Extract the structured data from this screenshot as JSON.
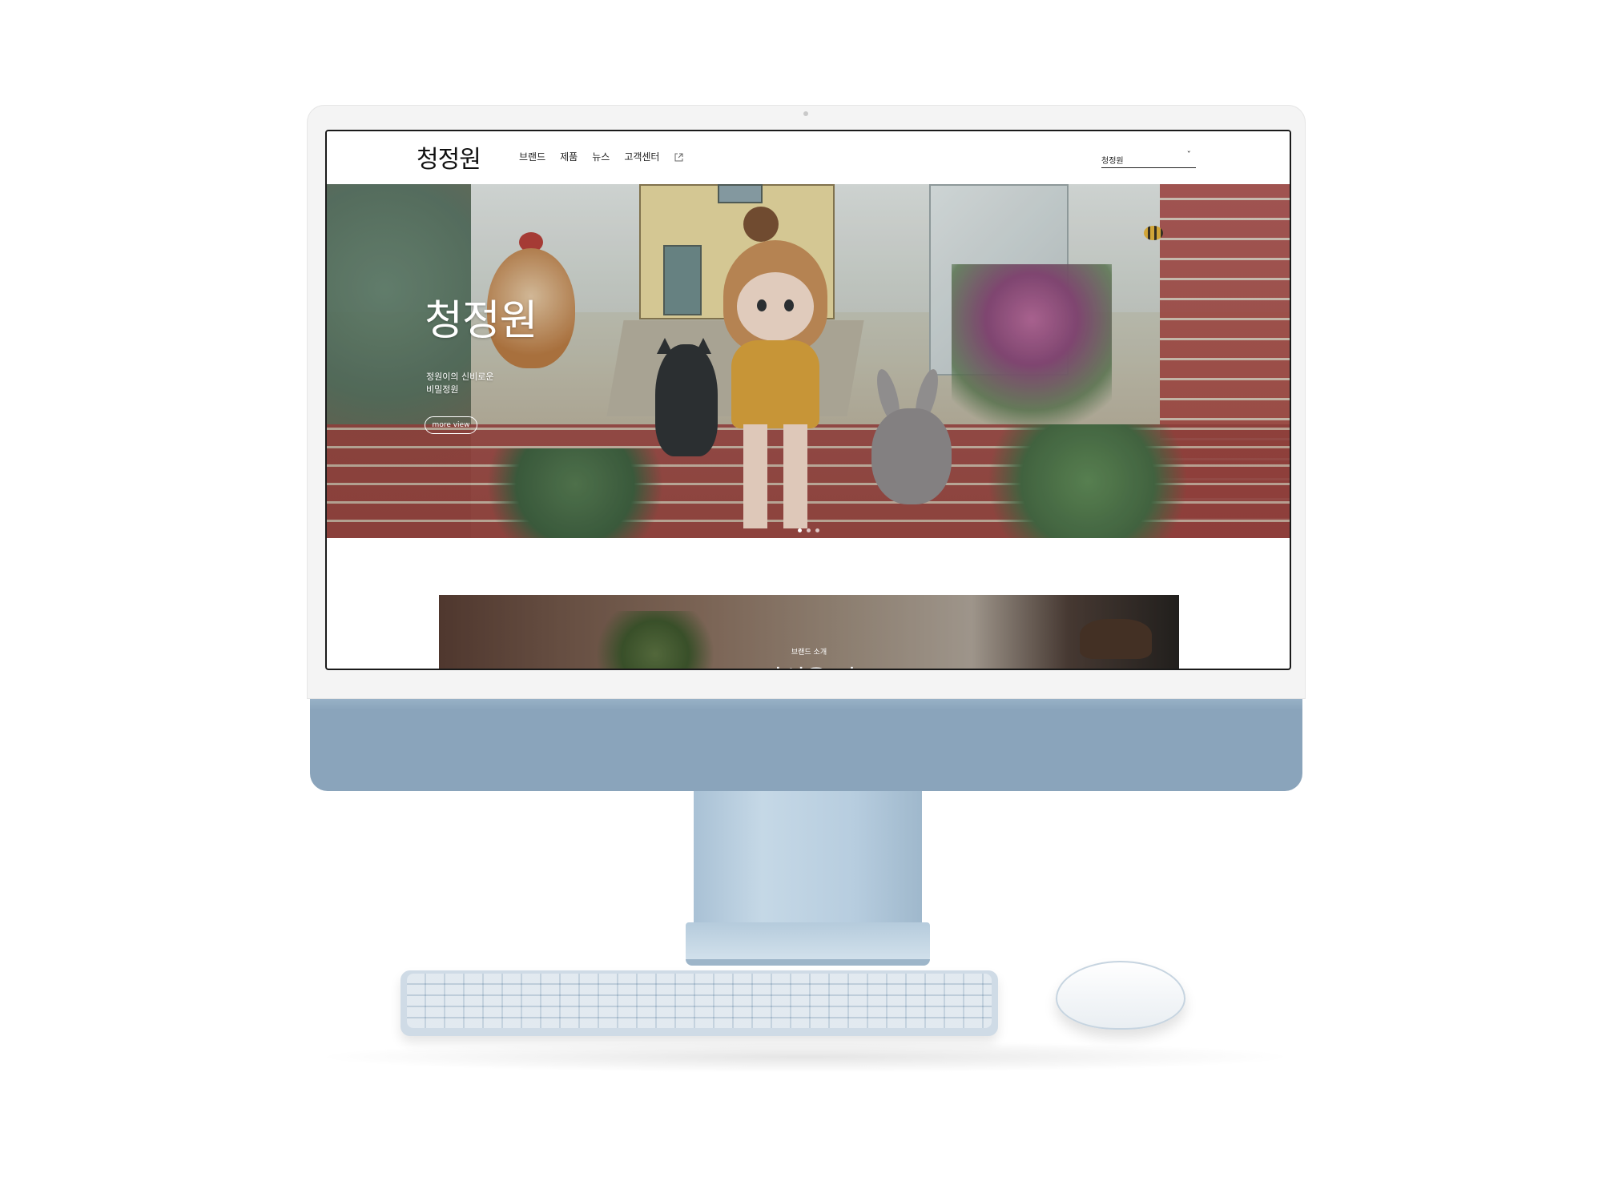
{
  "site": {
    "logo": "청정원",
    "nav": [
      "브랜드",
      "제품",
      "뉴스",
      "고객센터"
    ],
    "language_select": {
      "value": "청정원",
      "chevron": "ˇ"
    }
  },
  "hero": {
    "title": "청정원",
    "subtitle_line1": "정원이의 신비로운",
    "subtitle_line2": "비밀정원",
    "button": "more view",
    "slides": 3,
    "active_slide": 1
  },
  "brand_section": {
    "label": "브랜드 소개",
    "title": "당신을 마"
  },
  "colors": {
    "chin": "#8aa4bb",
    "bezel": "#f4f4f4",
    "text_dark": "#222222",
    "hero_text": "#ffffff"
  },
  "icons": [
    "external-link-icon",
    "chevron-down-icon"
  ]
}
